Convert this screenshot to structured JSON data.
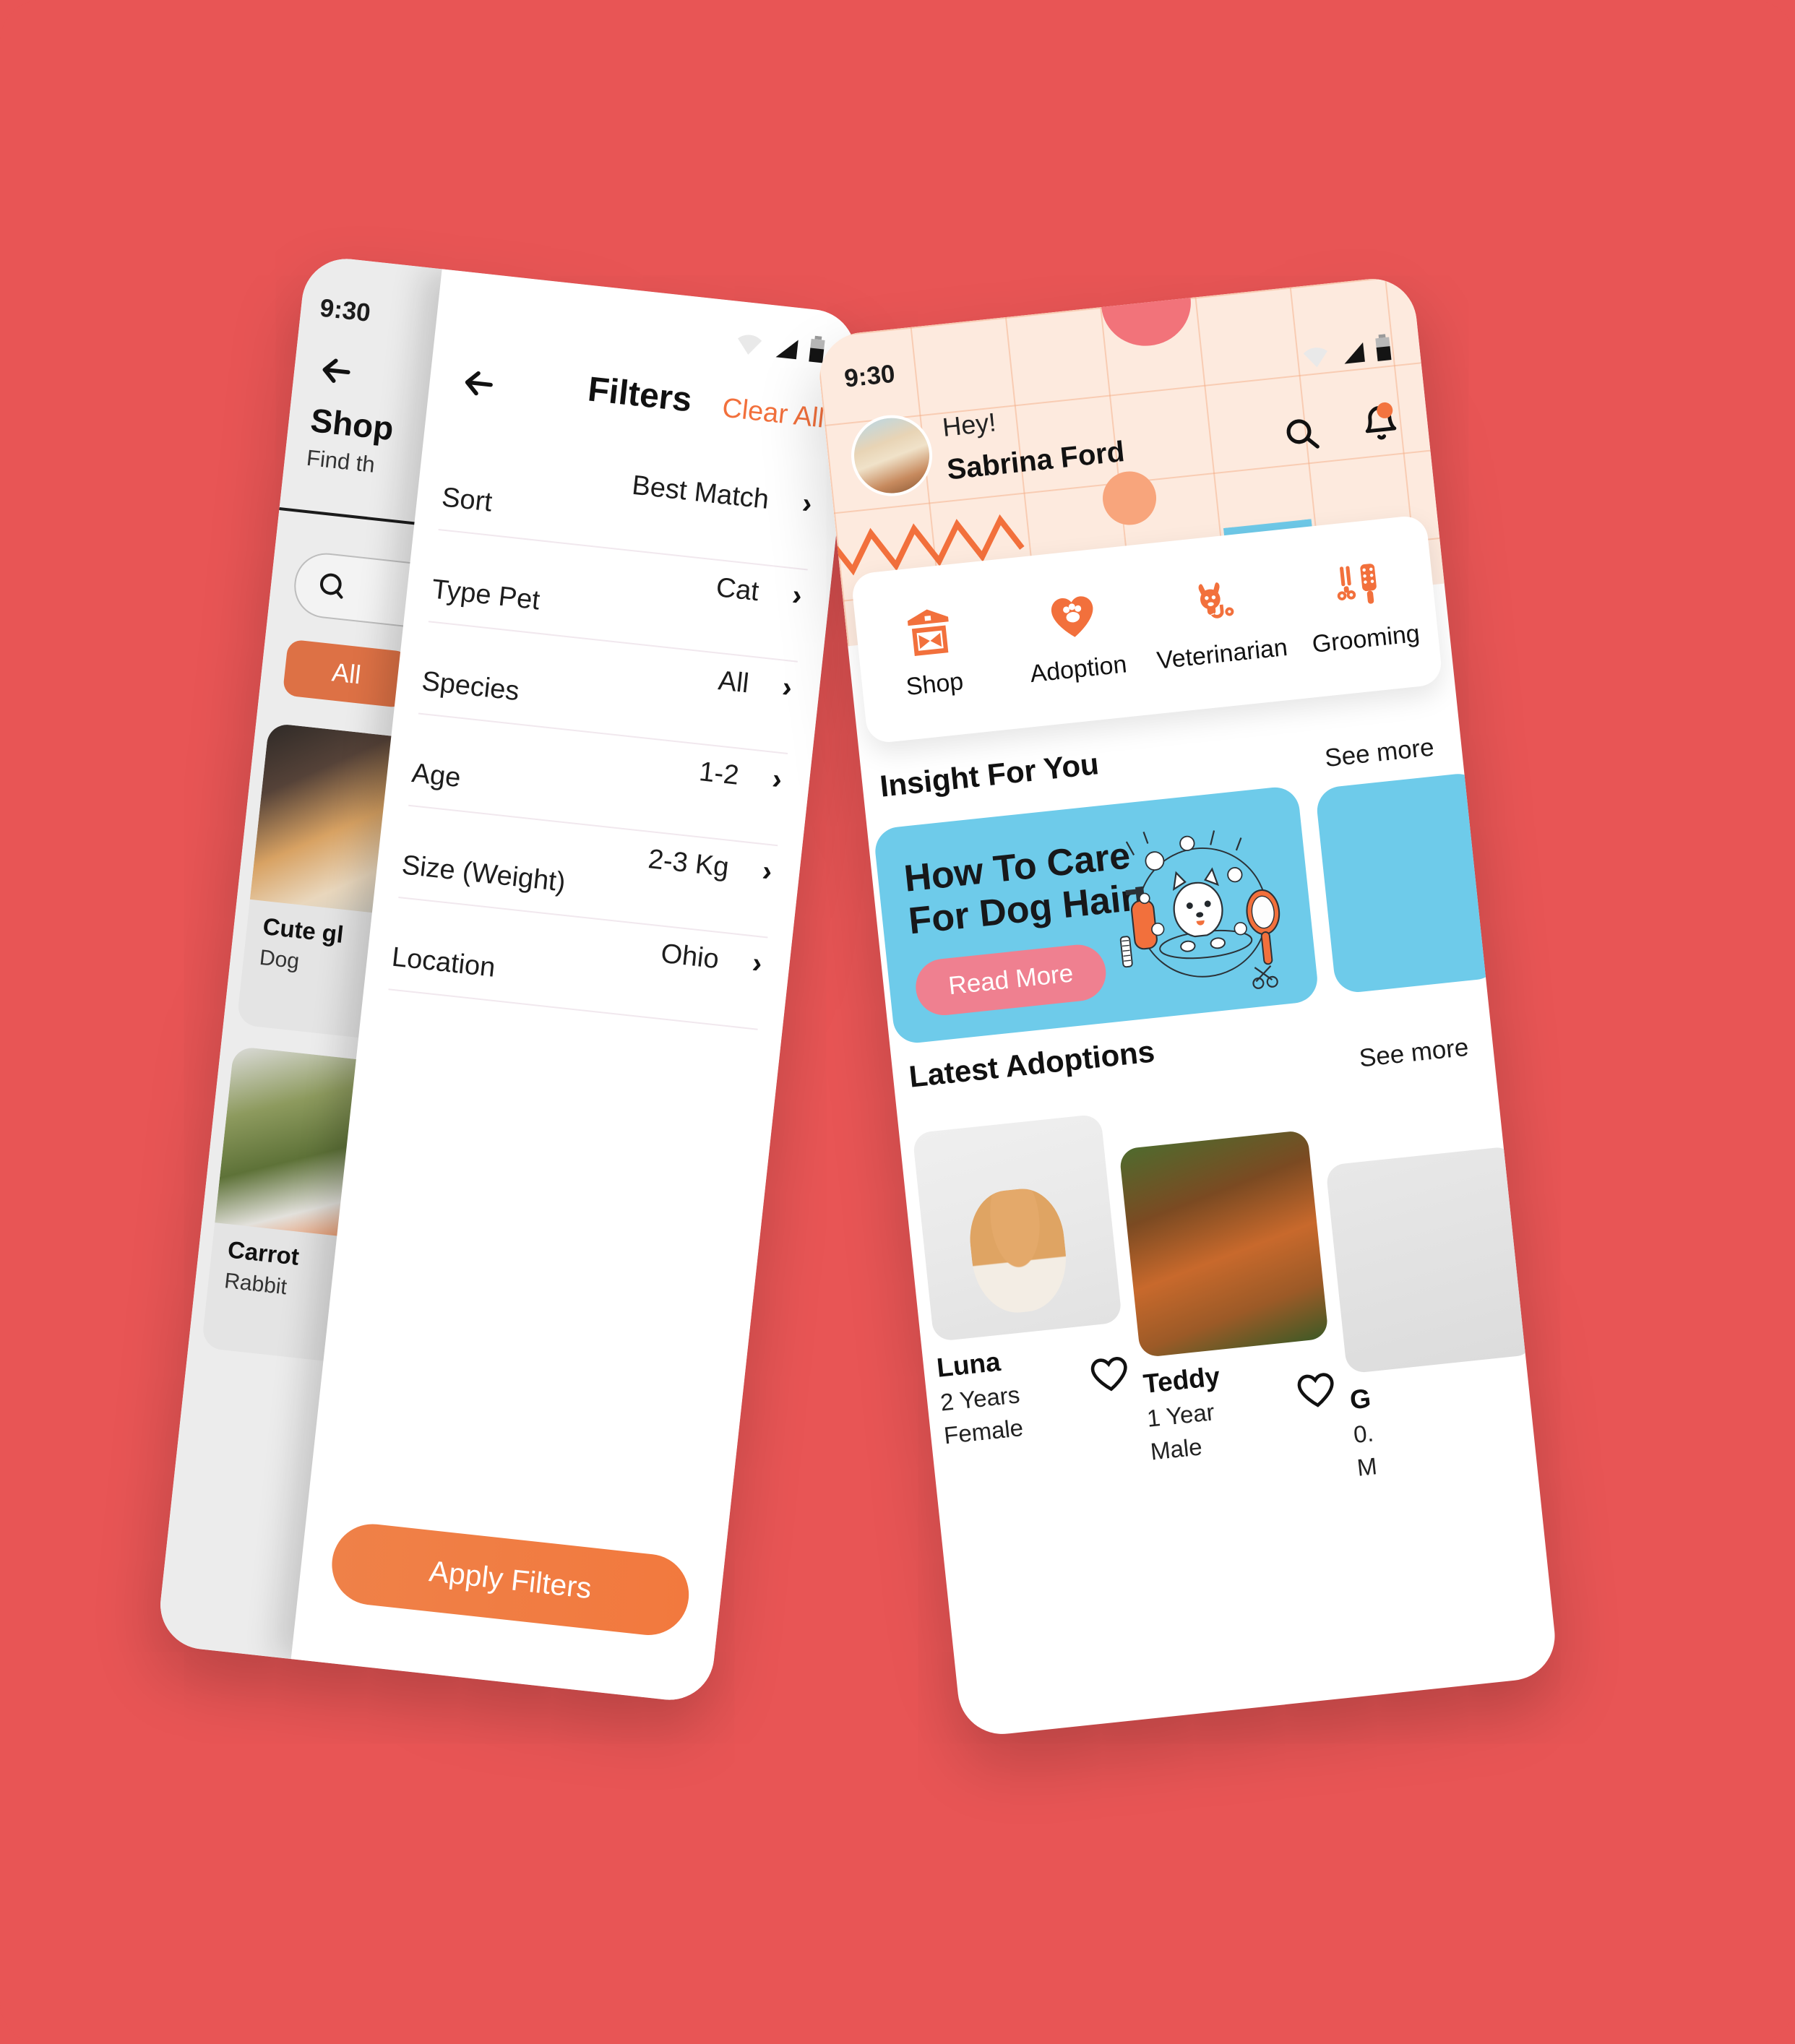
{
  "canvas": {
    "background_color": "#e85555"
  },
  "left_phone": {
    "status_time": "9:30",
    "underlying_screen": {
      "back_icon": "arrow-left-icon",
      "title": "Shop",
      "subtitle": "Find th",
      "search_icon": "search-icon",
      "chip_all": "All",
      "pet_cards": [
        {
          "name": "Cute gl",
          "kind": "Dog"
        },
        {
          "name": "Carrot",
          "kind": "Rabbit"
        }
      ]
    },
    "filters": {
      "back_icon": "arrow-left-icon",
      "title": "Filters",
      "clear_all": "Clear All",
      "clear_all_color": "#f2703c",
      "rows": [
        {
          "label": "Sort",
          "value": "Best Match",
          "chevron": "chevron-right-icon"
        },
        {
          "label": "Type Pet",
          "value": "Cat",
          "chevron": "chevron-right-icon"
        },
        {
          "label": "Species",
          "value": "All",
          "chevron": "chevron-right-icon"
        },
        {
          "label": "Age",
          "value": "1-2",
          "chevron": "chevron-right-icon"
        },
        {
          "label": "Size (Weight)",
          "value": "2-3 Kg",
          "chevron": "chevron-right-icon"
        },
        {
          "label": "Location",
          "value": "Ohio",
          "chevron": "chevron-right-icon"
        }
      ],
      "apply_button": "Apply Filters",
      "apply_button_color": "#f2793e"
    }
  },
  "right_phone": {
    "status_time": "9:30",
    "header": {
      "avatar": "user-avatar",
      "greeting": "Hey!",
      "user_name": "Sabrina Ford",
      "search_icon": "search-icon",
      "notification_icon": "bell-icon",
      "notification_badge_color": "#f3743f",
      "background_color": "#fdeade"
    },
    "categories": [
      {
        "label": "Shop",
        "icon": "barn-icon"
      },
      {
        "label": "Adoption",
        "icon": "heart-paw-icon"
      },
      {
        "label": "Veterinarian",
        "icon": "dog-stethoscope-icon"
      },
      {
        "label": "Grooming",
        "icon": "grooming-tools-icon"
      }
    ],
    "insight_section": {
      "heading": "Insight For You",
      "see_more": "See more",
      "card": {
        "title_line1": "How To Care",
        "title_line2": "For Dog Hair",
        "button": "Read More",
        "card_color": "#6ecbea",
        "button_color": "#ef8090",
        "illustration": "dog-bath-grooming-illustration"
      }
    },
    "adoption_section": {
      "heading": "Latest Adoptions",
      "see_more": "See more",
      "cards": [
        {
          "name": "Luna",
          "age": "2 Years",
          "gender": "Female",
          "favorite_icon": "heart-outline-icon",
          "image": "corgi-photo"
        },
        {
          "name": "Teddy",
          "age": "1 Year",
          "gender": "Male",
          "favorite_icon": "heart-outline-icon",
          "image": "retriever-photo"
        },
        {
          "name": "G",
          "age": "0.",
          "gender": "M",
          "favorite_icon": "heart-outline-icon",
          "image": "pet-photo"
        }
      ]
    }
  }
}
